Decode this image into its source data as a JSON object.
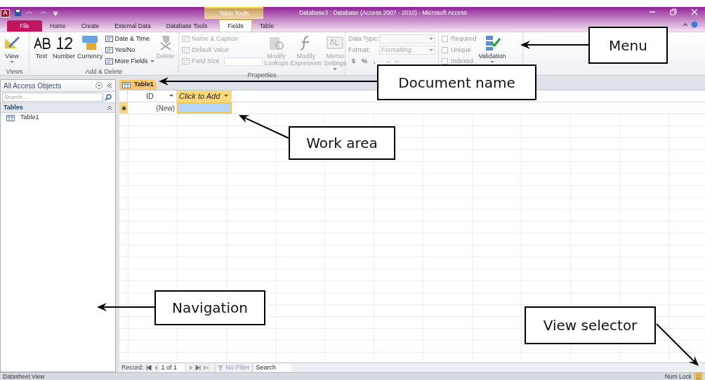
{
  "title_bar": {
    "app_letter": "A",
    "title": "Database3 : Database (Access 2007 - 2010)  -  Microsoft Access",
    "contextual_group": "Table Tools"
  },
  "ribbon_tabs": [
    {
      "label": "File",
      "selected": false,
      "kind": "file"
    },
    {
      "label": "Home",
      "selected": false,
      "kind": "tab"
    },
    {
      "label": "Create",
      "selected": false,
      "kind": "tab"
    },
    {
      "label": "External Data",
      "selected": false,
      "kind": "tab"
    },
    {
      "label": "Database Tools",
      "selected": false,
      "kind": "tab"
    },
    {
      "label": "Fields",
      "selected": true,
      "kind": "contextual"
    },
    {
      "label": "Table",
      "selected": false,
      "kind": "contextual"
    }
  ],
  "ribbon_groups": [
    {
      "label": "Views",
      "items": [
        {
          "kind": "large",
          "label": "View",
          "dropdown": true,
          "disabled": false
        }
      ]
    },
    {
      "label": "Add & Delete",
      "items": [
        {
          "kind": "large",
          "label": "Text",
          "disabled": false
        },
        {
          "kind": "large",
          "label": "Number",
          "disabled": false
        },
        {
          "kind": "large",
          "label": "Currency",
          "disabled": false
        },
        {
          "kind": "stack",
          "entries": [
            {
              "label": "Date & Time",
              "disabled": false
            },
            {
              "label": "Yes/No",
              "disabled": false
            },
            {
              "label": "More Fields",
              "dropdown": true,
              "disabled": false
            }
          ]
        },
        {
          "kind": "large",
          "label": "Delete",
          "disabled": true
        }
      ]
    },
    {
      "label": "Properties",
      "items": [
        {
          "kind": "stack",
          "entries": [
            {
              "label": "Name & Caption",
              "disabled": true
            },
            {
              "label": "Default Value",
              "disabled": true
            },
            {
              "label": "Field Size",
              "disabled": true,
              "field": true
            }
          ]
        },
        {
          "kind": "large",
          "label": "Modify\nLookups",
          "disabled": true
        },
        {
          "kind": "large",
          "label": "Modify\nExpression",
          "disabled": true
        },
        {
          "kind": "large",
          "label": "Memo\nSettings",
          "dropdown": true,
          "disabled": true
        }
      ]
    },
    {
      "items": [
        {
          "kind": "form",
          "rows": [
            {
              "label": "Data Type:",
              "value": ""
            },
            {
              "label": "Format:",
              "value": "Formatting"
            }
          ],
          "symbols": [
            "$",
            "%",
            ","
          ]
        }
      ]
    },
    {
      "items": [
        {
          "kind": "checks",
          "entries": [
            {
              "label": "Required",
              "checked": false
            },
            {
              "label": "Unique",
              "checked": false
            },
            {
              "label": "Indexed",
              "checked": false
            }
          ]
        },
        {
          "kind": "large",
          "label": "Validation",
          "dropdown": true,
          "disabled": false
        }
      ]
    }
  ],
  "navigation_pane": {
    "header": "All Access Objects",
    "search": {
      "placeholder": "Search..."
    },
    "groups": [
      {
        "label": "Tables",
        "expanded": true,
        "items": [
          {
            "label": "Table1",
            "selected": false
          }
        ]
      }
    ]
  },
  "document_tabs": [
    {
      "label": "Table1",
      "selected": true
    }
  ],
  "datasheet": {
    "columns": [
      {
        "label": "ID",
        "selected": false
      },
      {
        "label": "Click to Add",
        "selected": true
      }
    ],
    "new_row": {
      "cells": [
        "(New)",
        ""
      ]
    }
  },
  "record_navigator": {
    "label": "Record:",
    "position": "1 of 1",
    "filter": "No Filter",
    "search": "Search"
  },
  "status_bar": {
    "left": "Datasheet View",
    "right": "Num Lock"
  },
  "callouts": [
    {
      "text": "Menu"
    },
    {
      "text": "Document name"
    },
    {
      "text": "Work area"
    },
    {
      "text": "Navigation"
    },
    {
      "text": "View selector"
    }
  ]
}
